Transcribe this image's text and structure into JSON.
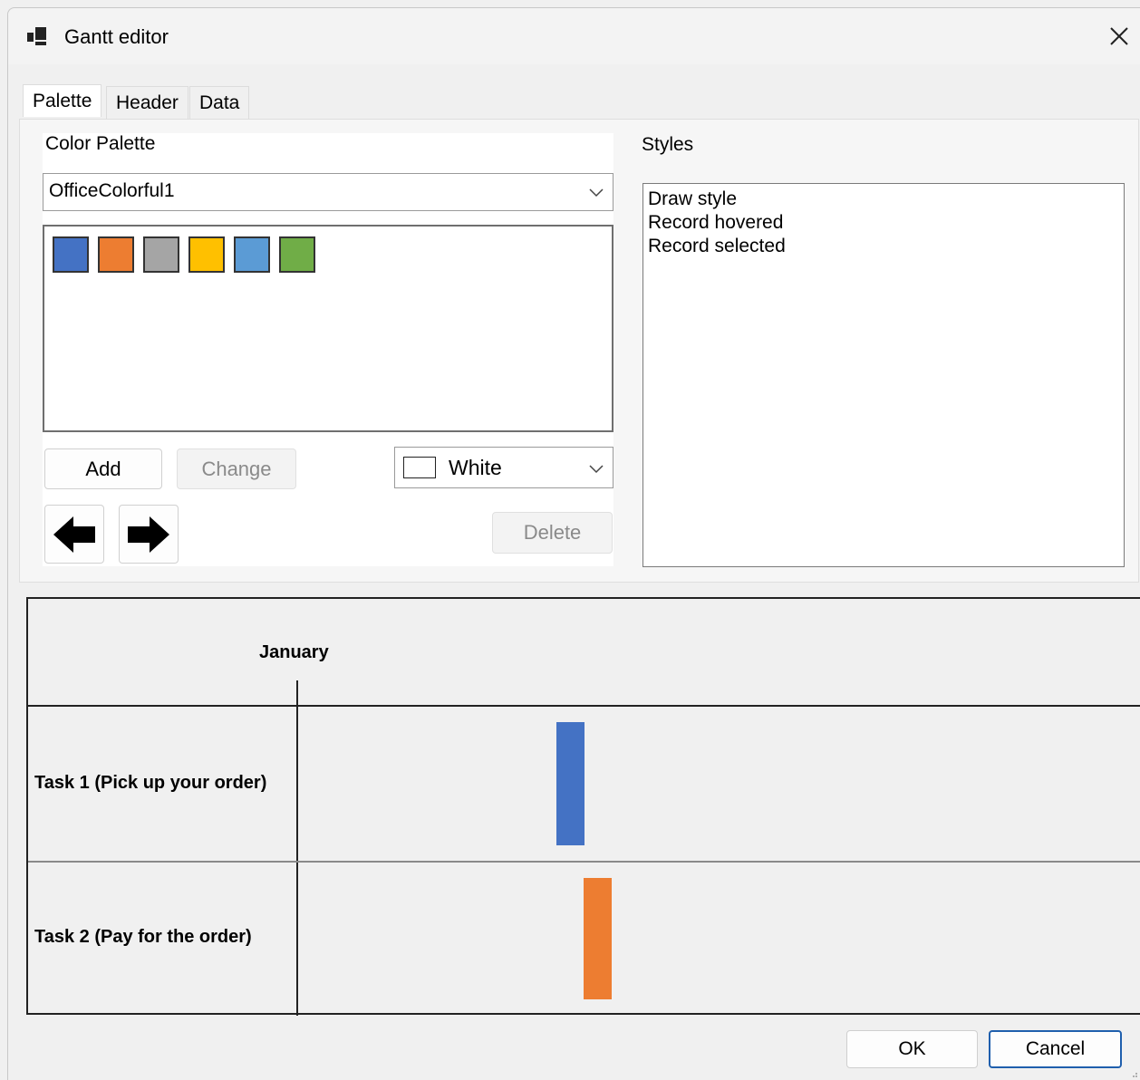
{
  "window": {
    "title": "Gantt editor"
  },
  "tabs": [
    {
      "label": "Palette",
      "active": true
    },
    {
      "label": "Header",
      "active": false
    },
    {
      "label": "Data",
      "active": false
    }
  ],
  "palette": {
    "section_label": "Color Palette",
    "selected_palette": "OfficeColorful1",
    "swatches": [
      "#4472c4",
      "#ed7d31",
      "#a5a5a5",
      "#ffc000",
      "#5b9bd5",
      "#70ad47"
    ],
    "add_label": "Add",
    "change_label": "Change",
    "color_value": "White",
    "delete_label": "Delete"
  },
  "styles": {
    "section_label": "Styles",
    "items": [
      "Draw style",
      "Record hovered",
      "Record selected"
    ]
  },
  "gantt": {
    "month_label": "January",
    "tasks": [
      {
        "label": "Task 1 (Pick up your order)",
        "color": "#4472c4"
      },
      {
        "label": "Task 2 (Pay for the order)",
        "color": "#ed7d31"
      }
    ]
  },
  "footer": {
    "ok_label": "OK",
    "cancel_label": "Cancel"
  }
}
